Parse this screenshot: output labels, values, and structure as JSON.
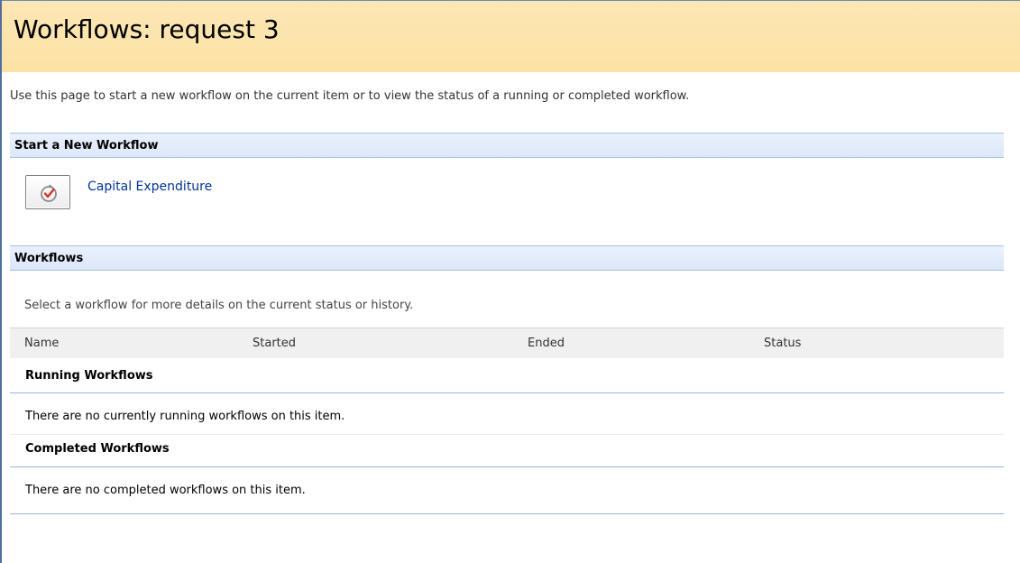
{
  "page": {
    "title": "Workflows: request 3",
    "description": "Use this page to start a new workflow on the current item or to view the status of a running or completed workflow."
  },
  "start_section": {
    "header": "Start a New Workflow",
    "workflows": [
      {
        "label": "Capital Expenditure",
        "icon": "workflow-check-icon"
      }
    ]
  },
  "workflows_section": {
    "header": "Workflows",
    "subtitle": "Select a workflow for more details on the current status or history.",
    "columns": [
      "Name",
      "Started",
      "Ended",
      "Status"
    ],
    "groups": [
      {
        "title": "Running Workflows",
        "empty_message": "There are no currently running workflows on this item."
      },
      {
        "title": "Completed Workflows",
        "empty_message": "There are no completed workflows on this item."
      }
    ]
  },
  "colors": {
    "header_bg": "#fde2a6",
    "section_bg": "#dce7f8",
    "link": "#003399",
    "rule": "#95b3e0"
  }
}
